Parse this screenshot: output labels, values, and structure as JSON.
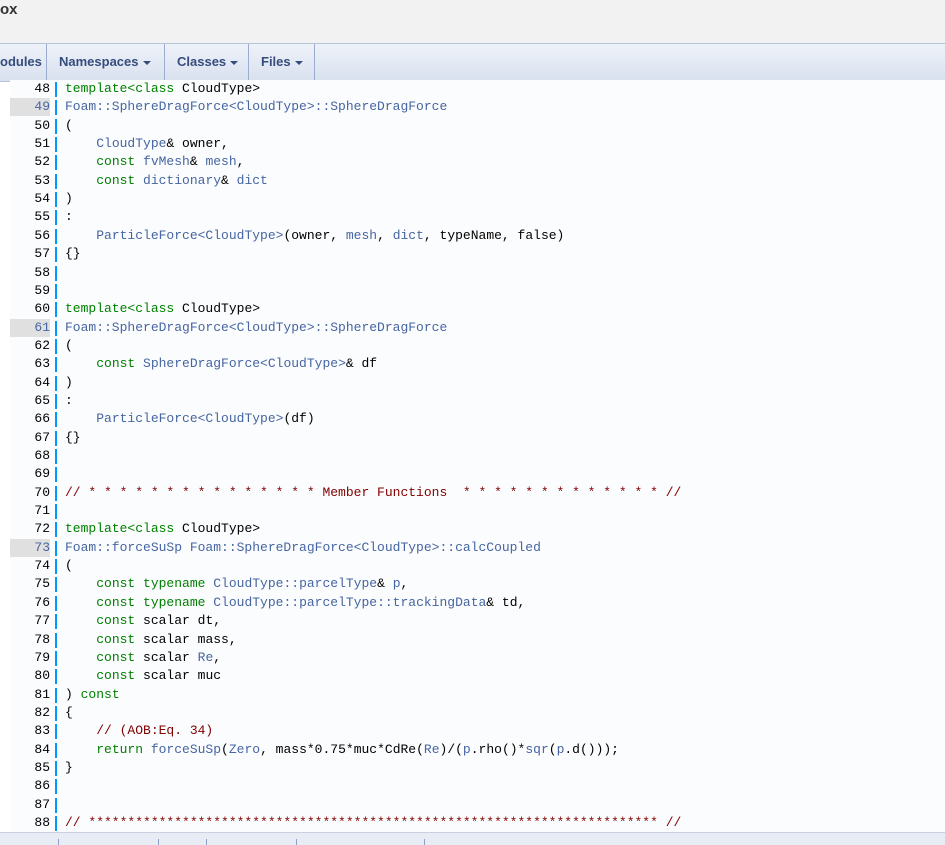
{
  "window": {
    "title_fragment": "ox"
  },
  "nav": [
    {
      "label": "odules",
      "dropdown": false
    },
    {
      "label": "Namespaces",
      "dropdown": true
    },
    {
      "label": "Classes",
      "dropdown": true
    },
    {
      "label": "Files",
      "dropdown": true
    }
  ],
  "code_lines": [
    {
      "n": "48",
      "hl": false,
      "tokens": [
        [
          "kt",
          "template<class "
        ],
        [
          "",
          "CloudType>"
        ]
      ]
    },
    {
      "n": "49",
      "hl": true,
      "tokens": [
        [
          "ty",
          "Foam::SphereDragForce<CloudType>::SphereDragForce"
        ]
      ]
    },
    {
      "n": "50",
      "hl": false,
      "tokens": [
        [
          "",
          "("
        ]
      ]
    },
    {
      "n": "51",
      "hl": false,
      "tokens": [
        [
          "",
          "    "
        ],
        [
          "ty",
          "CloudType"
        ],
        [
          "",
          "& owner,"
        ]
      ]
    },
    {
      "n": "52",
      "hl": false,
      "tokens": [
        [
          "",
          "    "
        ],
        [
          "kt",
          "const "
        ],
        [
          "ty",
          "fvMesh"
        ],
        [
          "",
          "& "
        ],
        [
          "ty",
          "mesh"
        ],
        [
          "",
          ","
        ]
      ]
    },
    {
      "n": "53",
      "hl": false,
      "tokens": [
        [
          "",
          "    "
        ],
        [
          "kt",
          "const "
        ],
        [
          "ty",
          "dictionary"
        ],
        [
          "",
          "& "
        ],
        [
          "ty",
          "dict"
        ]
      ]
    },
    {
      "n": "54",
      "hl": false,
      "tokens": [
        [
          "",
          ")"
        ]
      ]
    },
    {
      "n": "55",
      "hl": false,
      "tokens": [
        [
          "",
          ":"
        ]
      ]
    },
    {
      "n": "56",
      "hl": false,
      "tokens": [
        [
          "",
          "    "
        ],
        [
          "ty",
          "ParticleForce<CloudType>"
        ],
        [
          "",
          "(owner, "
        ],
        [
          "ty",
          "mesh"
        ],
        [
          "",
          ", "
        ],
        [
          "ty",
          "dict"
        ],
        [
          "",
          ", typeName, false)"
        ]
      ]
    },
    {
      "n": "57",
      "hl": false,
      "tokens": [
        [
          "",
          "{}"
        ]
      ]
    },
    {
      "n": "58",
      "hl": false,
      "tokens": []
    },
    {
      "n": "59",
      "hl": false,
      "tokens": []
    },
    {
      "n": "60",
      "hl": false,
      "tokens": [
        [
          "kt",
          "template<class "
        ],
        [
          "",
          "CloudType>"
        ]
      ]
    },
    {
      "n": "61",
      "hl": true,
      "tokens": [
        [
          "ty",
          "Foam::SphereDragForce<CloudType>::SphereDragForce"
        ]
      ]
    },
    {
      "n": "62",
      "hl": false,
      "tokens": [
        [
          "",
          "("
        ]
      ]
    },
    {
      "n": "63",
      "hl": false,
      "tokens": [
        [
          "",
          "    "
        ],
        [
          "kt",
          "const "
        ],
        [
          "ty",
          "SphereDragForce<CloudType>"
        ],
        [
          "",
          "& df"
        ]
      ]
    },
    {
      "n": "64",
      "hl": false,
      "tokens": [
        [
          "",
          ")"
        ]
      ]
    },
    {
      "n": "65",
      "hl": false,
      "tokens": [
        [
          "",
          ":"
        ]
      ]
    },
    {
      "n": "66",
      "hl": false,
      "tokens": [
        [
          "",
          "    "
        ],
        [
          "ty",
          "ParticleForce<CloudType>"
        ],
        [
          "",
          "(df)"
        ]
      ]
    },
    {
      "n": "67",
      "hl": false,
      "tokens": [
        [
          "",
          "{}"
        ]
      ]
    },
    {
      "n": "68",
      "hl": false,
      "tokens": []
    },
    {
      "n": "69",
      "hl": false,
      "tokens": []
    },
    {
      "n": "70",
      "hl": false,
      "tokens": [
        [
          "cm",
          "// * * * * * * * * * * * * * * * Member Functions  * * * * * * * * * * * * * //"
        ]
      ]
    },
    {
      "n": "71",
      "hl": false,
      "tokens": []
    },
    {
      "n": "72",
      "hl": false,
      "tokens": [
        [
          "kt",
          "template<class "
        ],
        [
          "",
          "CloudType>"
        ]
      ]
    },
    {
      "n": "73",
      "hl": true,
      "tokens": [
        [
          "ty",
          "Foam::forceSuSp Foam::SphereDragForce<CloudType>::calcCoupled"
        ]
      ]
    },
    {
      "n": "74",
      "hl": false,
      "tokens": [
        [
          "",
          "("
        ]
      ]
    },
    {
      "n": "75",
      "hl": false,
      "tokens": [
        [
          "",
          "    "
        ],
        [
          "kt",
          "const typename "
        ],
        [
          "ty",
          "CloudType::parcelType"
        ],
        [
          "",
          "& "
        ],
        [
          "ty",
          "p"
        ],
        [
          "",
          ","
        ]
      ]
    },
    {
      "n": "76",
      "hl": false,
      "tokens": [
        [
          "",
          "    "
        ],
        [
          "kt",
          "const typename "
        ],
        [
          "ty",
          "CloudType::parcelType::trackingData"
        ],
        [
          "",
          "& td,"
        ]
      ]
    },
    {
      "n": "77",
      "hl": false,
      "tokens": [
        [
          "",
          "    "
        ],
        [
          "kt",
          "const "
        ],
        [
          "",
          "scalar dt,"
        ]
      ]
    },
    {
      "n": "78",
      "hl": false,
      "tokens": [
        [
          "",
          "    "
        ],
        [
          "kt",
          "const "
        ],
        [
          "",
          "scalar mass,"
        ]
      ]
    },
    {
      "n": "79",
      "hl": false,
      "tokens": [
        [
          "",
          "    "
        ],
        [
          "kt",
          "const "
        ],
        [
          "",
          "scalar "
        ],
        [
          "ty",
          "Re"
        ],
        [
          "",
          ","
        ]
      ]
    },
    {
      "n": "80",
      "hl": false,
      "tokens": [
        [
          "",
          "    "
        ],
        [
          "kt",
          "const "
        ],
        [
          "",
          "scalar muc"
        ]
      ]
    },
    {
      "n": "81",
      "hl": false,
      "tokens": [
        [
          "",
          ") "
        ],
        [
          "kt",
          "const"
        ]
      ]
    },
    {
      "n": "82",
      "hl": false,
      "tokens": [
        [
          "",
          "{"
        ]
      ]
    },
    {
      "n": "83",
      "hl": false,
      "tokens": [
        [
          "",
          "    "
        ],
        [
          "cm",
          "// (AOB:Eq. 34)"
        ]
      ]
    },
    {
      "n": "84",
      "hl": false,
      "tokens": [
        [
          "",
          "    "
        ],
        [
          "kt",
          "return "
        ],
        [
          "ty",
          "forceSuSp"
        ],
        [
          "",
          "("
        ],
        [
          "ty",
          "Zero"
        ],
        [
          "",
          ", mass*0.75*muc*CdRe("
        ],
        [
          "ty",
          "Re"
        ],
        [
          "",
          ")/("
        ],
        [
          "ty",
          "p"
        ],
        [
          "",
          ".rho()*"
        ],
        [
          "ty",
          "sqr"
        ],
        [
          "",
          "("
        ],
        [
          "ty",
          "p"
        ],
        [
          "",
          ".d()));"
        ]
      ]
    },
    {
      "n": "85",
      "hl": false,
      "tokens": [
        [
          "",
          "}"
        ]
      ]
    },
    {
      "n": "86",
      "hl": false,
      "tokens": []
    },
    {
      "n": "87",
      "hl": false,
      "tokens": []
    },
    {
      "n": "88",
      "hl": false,
      "tokens": [
        [
          "cm",
          "// ************************************************************************* //"
        ]
      ]
    }
  ]
}
